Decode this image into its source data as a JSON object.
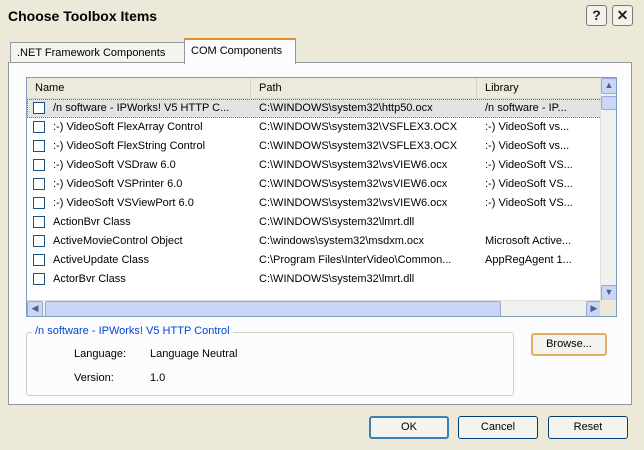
{
  "window": {
    "title": "Choose Toolbox Items",
    "help_label": "?",
    "close_label": "✕"
  },
  "tabs": [
    {
      "label": ".NET Framework Components"
    },
    {
      "label": "COM Components"
    }
  ],
  "list": {
    "columns": [
      "Name",
      "Path",
      "Library"
    ],
    "rows": [
      {
        "name": "/n software - IPWorks! V5 HTTP C...",
        "path": "C:\\WINDOWS\\system32\\http50.ocx",
        "library": "/n software - IP...",
        "checked": false,
        "selected": true
      },
      {
        "name": ":-) VideoSoft FlexArray Control",
        "path": "C:\\WINDOWS\\system32\\VSFLEX3.OCX",
        "library": ":-) VideoSoft vs...",
        "checked": false
      },
      {
        "name": ":-) VideoSoft FlexString Control",
        "path": "C:\\WINDOWS\\system32\\VSFLEX3.OCX",
        "library": ":-) VideoSoft vs...",
        "checked": false
      },
      {
        "name": ":-) VideoSoft VSDraw 6.0",
        "path": "C:\\WINDOWS\\system32\\vsVIEW6.ocx",
        "library": ":-) VideoSoft VS...",
        "checked": false
      },
      {
        "name": ":-) VideoSoft VSPrinter 6.0",
        "path": "C:\\WINDOWS\\system32\\vsVIEW6.ocx",
        "library": ":-) VideoSoft VS...",
        "checked": false
      },
      {
        "name": ":-) VideoSoft VSViewPort 6.0",
        "path": "C:\\WINDOWS\\system32\\vsVIEW6.ocx",
        "library": ":-) VideoSoft VS...",
        "checked": false
      },
      {
        "name": "ActionBvr Class",
        "path": "C:\\WINDOWS\\system32\\lmrt.dll",
        "library": "",
        "checked": false
      },
      {
        "name": "ActiveMovieControl Object",
        "path": "C:\\windows\\system32\\msdxm.ocx",
        "library": "Microsoft Active...",
        "checked": false
      },
      {
        "name": "ActiveUpdate Class",
        "path": "C:\\Program Files\\InterVideo\\Common...",
        "library": "AppRegAgent 1...",
        "checked": false
      },
      {
        "name": "ActorBvr Class",
        "path": "C:\\WINDOWS\\system32\\lmrt.dll",
        "library": "",
        "checked": false
      }
    ]
  },
  "details": {
    "legend": "/n software - IPWorks! V5 HTTP Control",
    "language_label": "Language:",
    "language_value": "Language Neutral",
    "version_label": "Version:",
    "version_value": "1.0"
  },
  "buttons": {
    "browse": "Browse...",
    "ok": "OK",
    "cancel": "Cancel",
    "reset": "Reset"
  },
  "colors": {
    "accent": "#0046d5",
    "tab_highlight": "#e68b2c",
    "selection": "#e3e3e3"
  }
}
